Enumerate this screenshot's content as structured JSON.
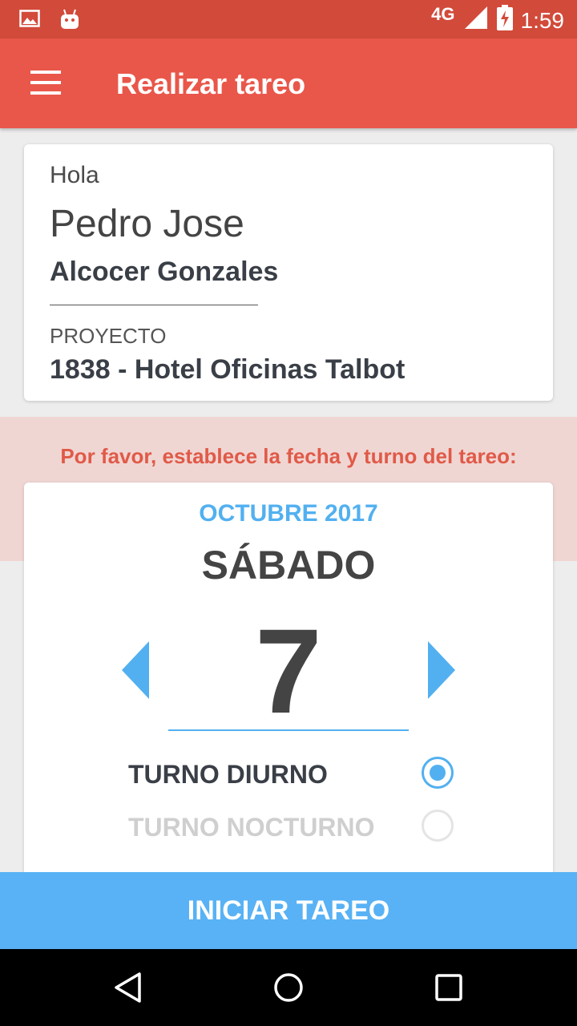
{
  "status_bar": {
    "network": "4G",
    "time": "1:59",
    "icons": [
      "image-icon",
      "android-icon",
      "signal-icon",
      "battery-charging-icon"
    ]
  },
  "app_bar": {
    "title": "Realizar tareo",
    "menu_icon": "hamburger-menu-icon"
  },
  "user_card": {
    "greeting": "Hola",
    "first_name": "Pedro Jose",
    "last_name": "Alcocer Gonzales",
    "project_label": "PROYECTO",
    "project_value": "1838 - Hotel Oficinas Talbot"
  },
  "instruction": "Por favor, establece la fecha y turno del tareo:",
  "date_picker": {
    "month_year": "OCTUBRE 2017",
    "weekday": "SÁBADO",
    "day": "7",
    "prev_icon": "chevron-left-icon",
    "next_icon": "chevron-right-icon"
  },
  "shifts": [
    {
      "label": "TURNO DIURNO",
      "selected": true
    },
    {
      "label": "TURNO NOCTURNO",
      "selected": false
    }
  ],
  "start_button": "INICIAR TAREO",
  "nav_bar": [
    "back-icon",
    "home-icon",
    "recents-icon"
  ],
  "colors": {
    "status_bar": "#d24a3a",
    "app_bar": "#e9574a",
    "accent_blue": "#52b0f0",
    "button": "#58b2f5",
    "pink_band": "#f0d6d3",
    "instruction_text": "#e05a48"
  }
}
